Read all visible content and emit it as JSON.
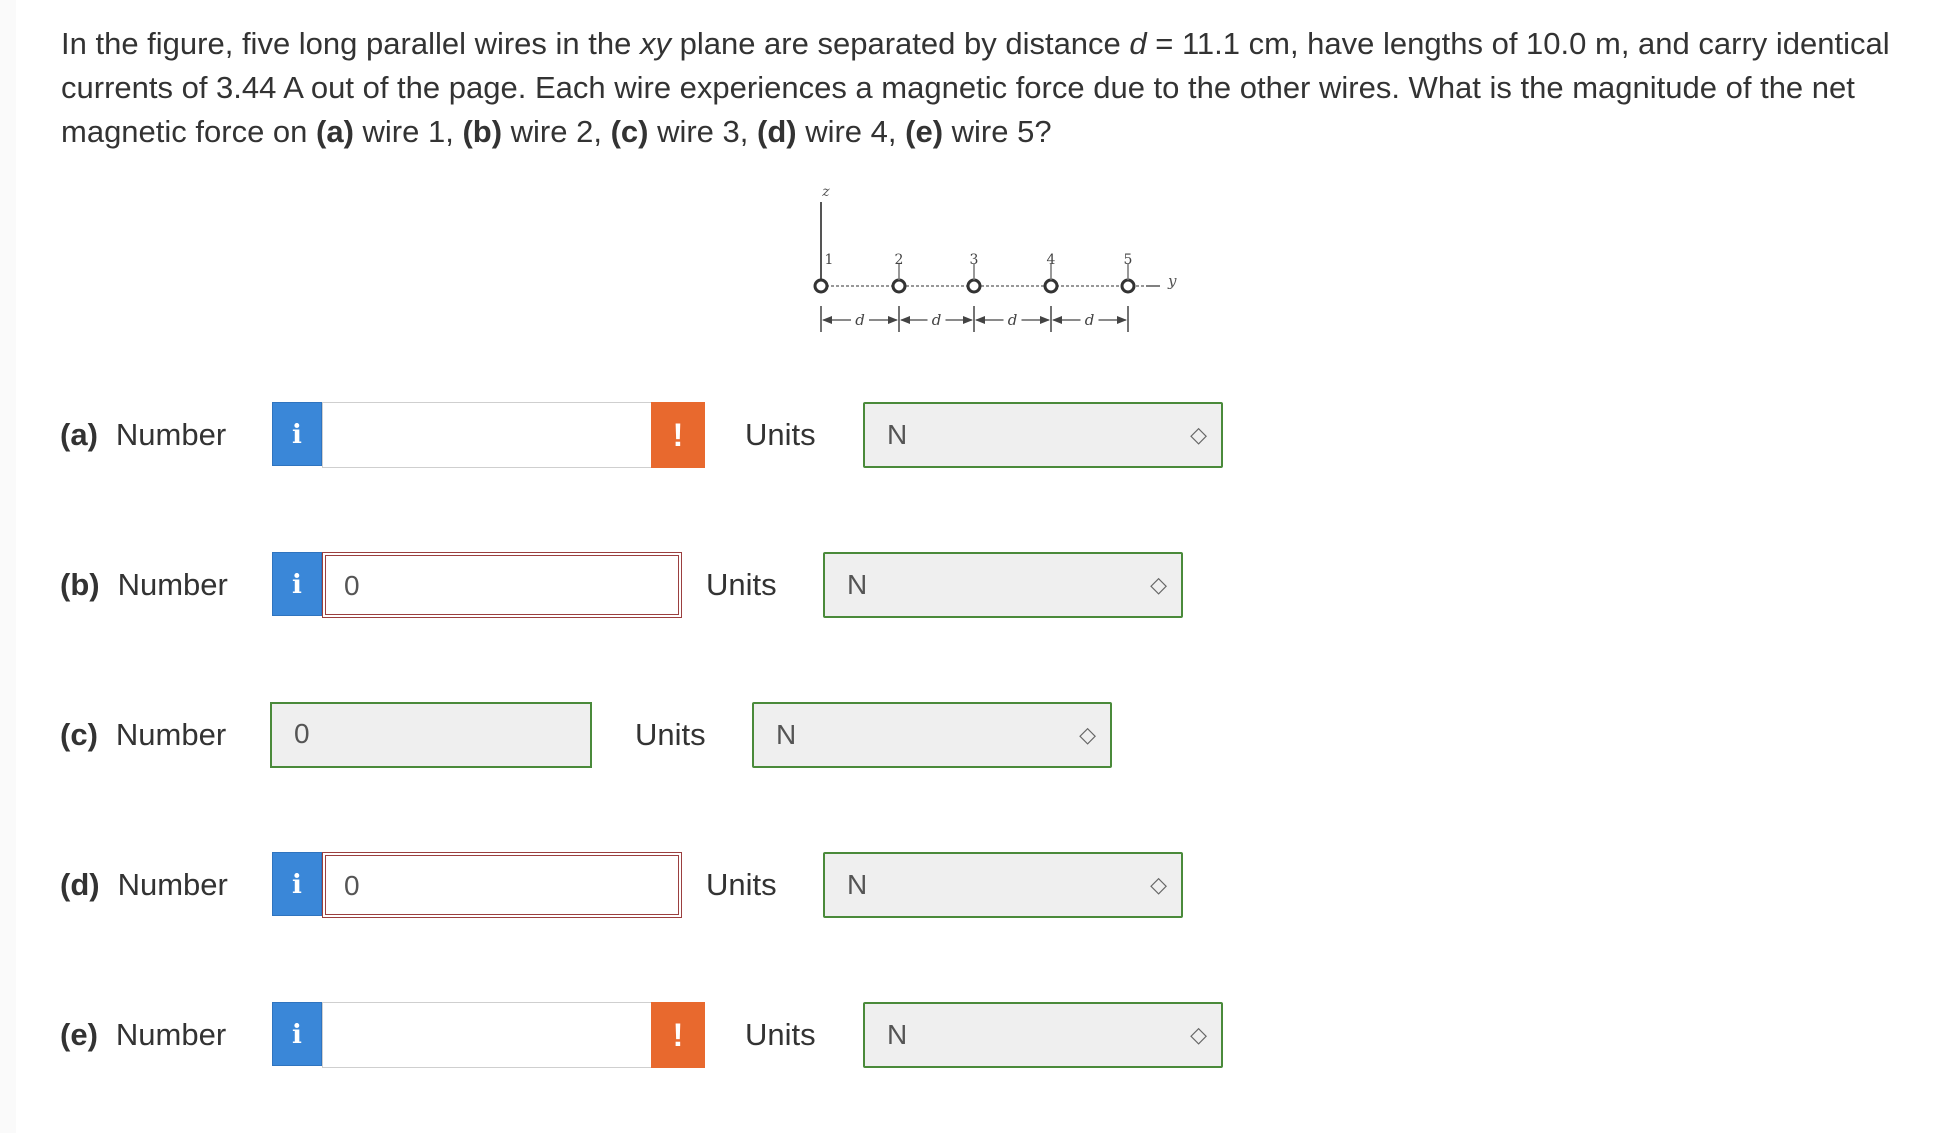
{
  "question": {
    "segments": [
      {
        "t": "In the figure, five long parallel wires in the ",
        "s": "n"
      },
      {
        "t": "xy",
        "s": "i"
      },
      {
        "t": " plane are separated by distance ",
        "s": "n"
      },
      {
        "t": "d",
        "s": "i"
      },
      {
        "t": " = 11.1 cm, have lengths of 10.0 m, and carry identical currents of 3.44 A out of the page. Each wire experiences a magnetic force due to the other wires. What is the magnitude of the net magnetic force on ",
        "s": "n"
      },
      {
        "t": "(a)",
        "s": "b"
      },
      {
        "t": " wire 1, ",
        "s": "n"
      },
      {
        "t": "(b)",
        "s": "b"
      },
      {
        "t": " wire 2, ",
        "s": "n"
      },
      {
        "t": "(c)",
        "s": "b"
      },
      {
        "t": " wire 3, ",
        "s": "n"
      },
      {
        "t": "(d)",
        "s": "b"
      },
      {
        "t": " wire 4, ",
        "s": "n"
      },
      {
        "t": "(e)",
        "s": "b"
      },
      {
        "t": " wire 5?",
        "s": "n"
      }
    ]
  },
  "figure": {
    "z_axis": "z",
    "y_axis": "y",
    "wire_labels": [
      "1",
      "2",
      "3",
      "4",
      "5"
    ],
    "spacing_label": "d"
  },
  "parts": [
    {
      "label": "(a)",
      "kind": "Number",
      "value": "",
      "state": "blank",
      "units_label": "Units",
      "units": "N"
    },
    {
      "label": "(b)",
      "kind": "Number",
      "value": "0",
      "state": "error",
      "units_label": "Units",
      "units": "N"
    },
    {
      "label": "(c)",
      "kind": "Number",
      "value": "0",
      "state": "readonly",
      "units_label": "Units",
      "units": "N"
    },
    {
      "label": "(d)",
      "kind": "Number",
      "value": "0",
      "state": "error",
      "units_label": "Units",
      "units": "N"
    },
    {
      "label": "(e)",
      "kind": "Number",
      "value": "",
      "state": "blank",
      "units_label": "Units",
      "units": "N"
    }
  ],
  "icons": {
    "info_glyph": "i",
    "warning_glyph": "!",
    "select_chevron": "◇"
  },
  "colors": {
    "info": "#3a87d8",
    "warning": "#e8692e",
    "correct_border": "#4a8a3a",
    "error_border": "#9b3f3f"
  }
}
